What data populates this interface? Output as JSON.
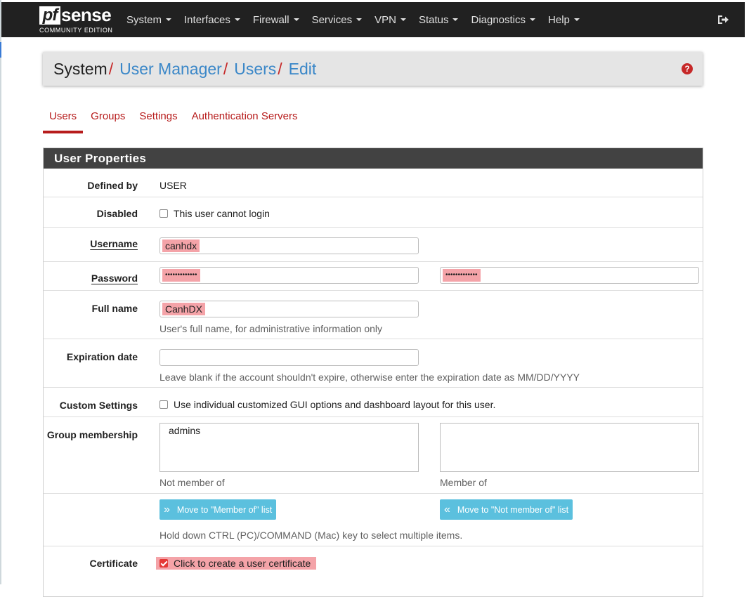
{
  "brand": {
    "logo_pf": "pf",
    "logo_sense": "sense",
    "edition": "COMMUNITY EDITION"
  },
  "nav": {
    "items": [
      {
        "label": "System"
      },
      {
        "label": "Interfaces"
      },
      {
        "label": "Firewall"
      },
      {
        "label": "Services"
      },
      {
        "label": "VPN"
      },
      {
        "label": "Status"
      },
      {
        "label": "Diagnostics"
      },
      {
        "label": "Help"
      }
    ],
    "logout_icon": "logout-icon"
  },
  "breadcrumb": {
    "root": "System",
    "items": [
      "User Manager",
      "Users",
      "Edit"
    ],
    "separator": "/",
    "help_icon": "question-circle-icon"
  },
  "tabs": [
    {
      "label": "Users",
      "active": true
    },
    {
      "label": "Groups",
      "active": false
    },
    {
      "label": "Settings",
      "active": false
    },
    {
      "label": "Authentication Servers",
      "active": false
    }
  ],
  "panel": {
    "title": "User Properties"
  },
  "form": {
    "defined_by": {
      "label": "Defined by",
      "value": "USER"
    },
    "disabled": {
      "label": "Disabled",
      "checkbox_label": "This user cannot login",
      "checked": false
    },
    "username": {
      "label": "Username",
      "value": "canhdx"
    },
    "password": {
      "label": "Password",
      "value": "•••••••••••••",
      "confirm_value": "•••••••••••••"
    },
    "full_name": {
      "label": "Full name",
      "value": "CanhDX",
      "help": "User's full name, for administrative information only"
    },
    "expiration": {
      "label": "Expiration date",
      "value": "",
      "help": "Leave blank if the account shouldn't expire, otherwise enter the expiration date as MM/DD/YYYY"
    },
    "custom_settings": {
      "label": "Custom Settings",
      "checkbox_label": "Use individual customized GUI options and dashboard layout for this user.",
      "checked": false
    },
    "groups": {
      "label": "Group membership",
      "not_member_items": [
        "admins"
      ],
      "member_items": [],
      "not_member_caption": "Not member of",
      "member_caption": "Member of"
    },
    "move_buttons": {
      "to_member": "Move to \"Member of\" list",
      "to_not_member": "Move to \"Not member of\" list",
      "help": "Hold down CTRL (PC)/COMMAND (Mac) key to select multiple items."
    },
    "certificate": {
      "label": "Certificate",
      "checkbox_label": "Click to create a user certificate",
      "checked": true
    }
  },
  "colors": {
    "navbar": "#212121",
    "accent_red": "#b71c1c",
    "link_blue": "#3a87c8",
    "button_info": "#5bc0de",
    "highlight": "#f4a3a8"
  }
}
